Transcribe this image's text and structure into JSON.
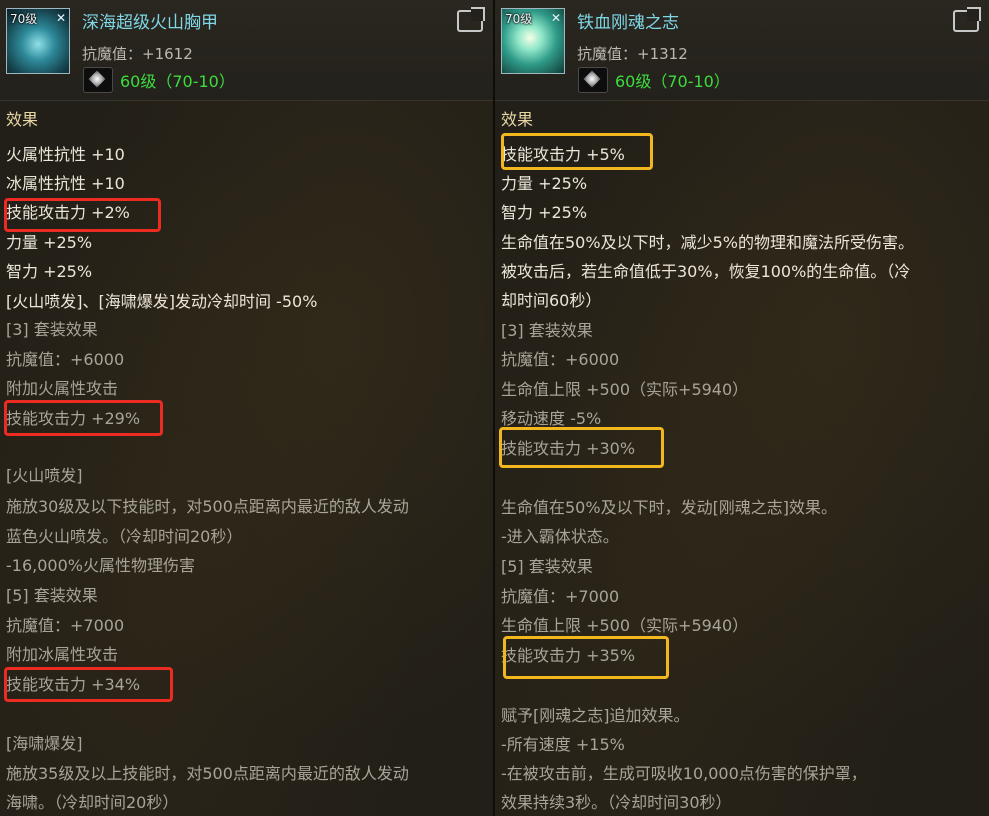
{
  "left": {
    "icon_level": "70级",
    "name": "深海超级火山胸甲",
    "resistance": "抗魔值：+1612",
    "level": "60级（70-10）",
    "lines": [
      "效果",
      "火属性抗性 +10",
      "冰属性抗性 +10",
      "技能攻击力 +2%",
      "力量 +25%",
      "智力 +25%",
      "[火山喷发]、[海啸爆发]发动冷却时间 -50%",
      "[3] 套装效果",
      "抗魔值：+6000",
      "附加火属性攻击",
      "技能攻击力 +29%",
      "[火山喷发]",
      "施放30级及以下技能时，对500点距离内最近的敌人发动",
      "蓝色火山喷发。（冷却时间20秒）",
      "-16,000%火属性物理伤害",
      "[5] 套装效果",
      "抗魔值：+7000",
      "附加冰属性攻击",
      "技能攻击力 +34%",
      "[海啸爆发]",
      "施放35级及以上技能时，对500点距离内最近的敌人发动",
      "海啸。（冷却时间20秒）"
    ]
  },
  "right": {
    "icon_level": "70级",
    "name": "铁血刚魂之志",
    "resistance": "抗魔值：+1312",
    "level": "60级（70-10）",
    "lines": [
      "效果",
      "技能攻击力 +5%",
      "力量 +25%",
      "智力 +25%",
      "生命值在50%及以下时，减少5%的物理和魔法所受伤害。",
      "被攻击后，若生命值低于30%，恢复100%的生命值。（冷",
      "却时间60秒）",
      "[3] 套装效果",
      "抗魔值：+6000",
      "生命值上限 +500（实际+5940）",
      "移动速度 -5%",
      "技能攻击力 +30%",
      "生命值在50%及以下时，发动[刚魂之志]效果。",
      "-进入霸体状态。",
      "[5] 套装效果",
      "抗魔值：+7000",
      "生命值上限 +500（实际+5940）",
      "技能攻击力 +35%",
      "赋予[刚魂之志]追加效果。",
      "-所有速度 +15%",
      "-在被攻击前，生成可吸收10,000点伤害的保护罩，",
      "效果持续3秒。（冷却时间30秒）"
    ]
  }
}
